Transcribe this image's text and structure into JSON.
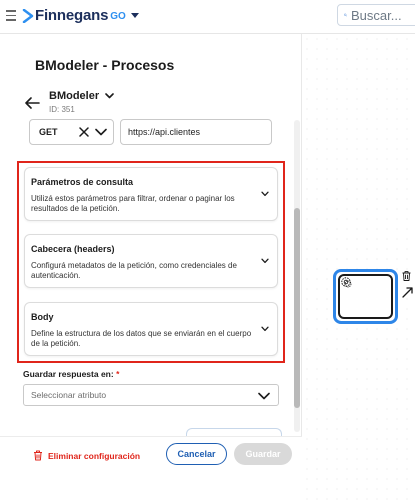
{
  "topbar": {
    "logo_text": "Finnegans",
    "logo_suffix": "GO",
    "search_placeholder": "Buscar..."
  },
  "panel": {
    "title": "BModeler - Procesos",
    "model_name": "BModeler",
    "model_id": "ID: 351"
  },
  "request": {
    "method": "GET",
    "url": "https://api.clientes"
  },
  "accordions": [
    {
      "title": "Parámetros de consulta",
      "description": "Utilizá estos parámetros para filtrar, ordenar o paginar los resultados de la petición."
    },
    {
      "title": "Cabecera (headers)",
      "description": "Configurá metadatos de la petición, como credenciales de autenticación."
    },
    {
      "title": "Body",
      "description": "Define la estructura de los datos que se enviarán en el cuerpo de la petición."
    }
  ],
  "save_response": {
    "label": "Guardar respuesta en:",
    "required_mark": "*",
    "placeholder": "Seleccionar atributo"
  },
  "footer": {
    "delete_label": "Eliminar configuración",
    "cancel_label": "Cancelar",
    "save_label": "Guardar"
  },
  "colors": {
    "brand_blue": "#1f5fb3",
    "accent_blue": "#2e86e8",
    "danger_red": "#e0251b",
    "disabled_gray": "#d9d9d9"
  },
  "icons": [
    "menu-icon",
    "logo-arrow-icon",
    "chevron-down-icon",
    "search-icon",
    "back-arrow-icon",
    "clear-x-icon",
    "trash-icon",
    "gear-icon",
    "connect-arrow-icon"
  ]
}
